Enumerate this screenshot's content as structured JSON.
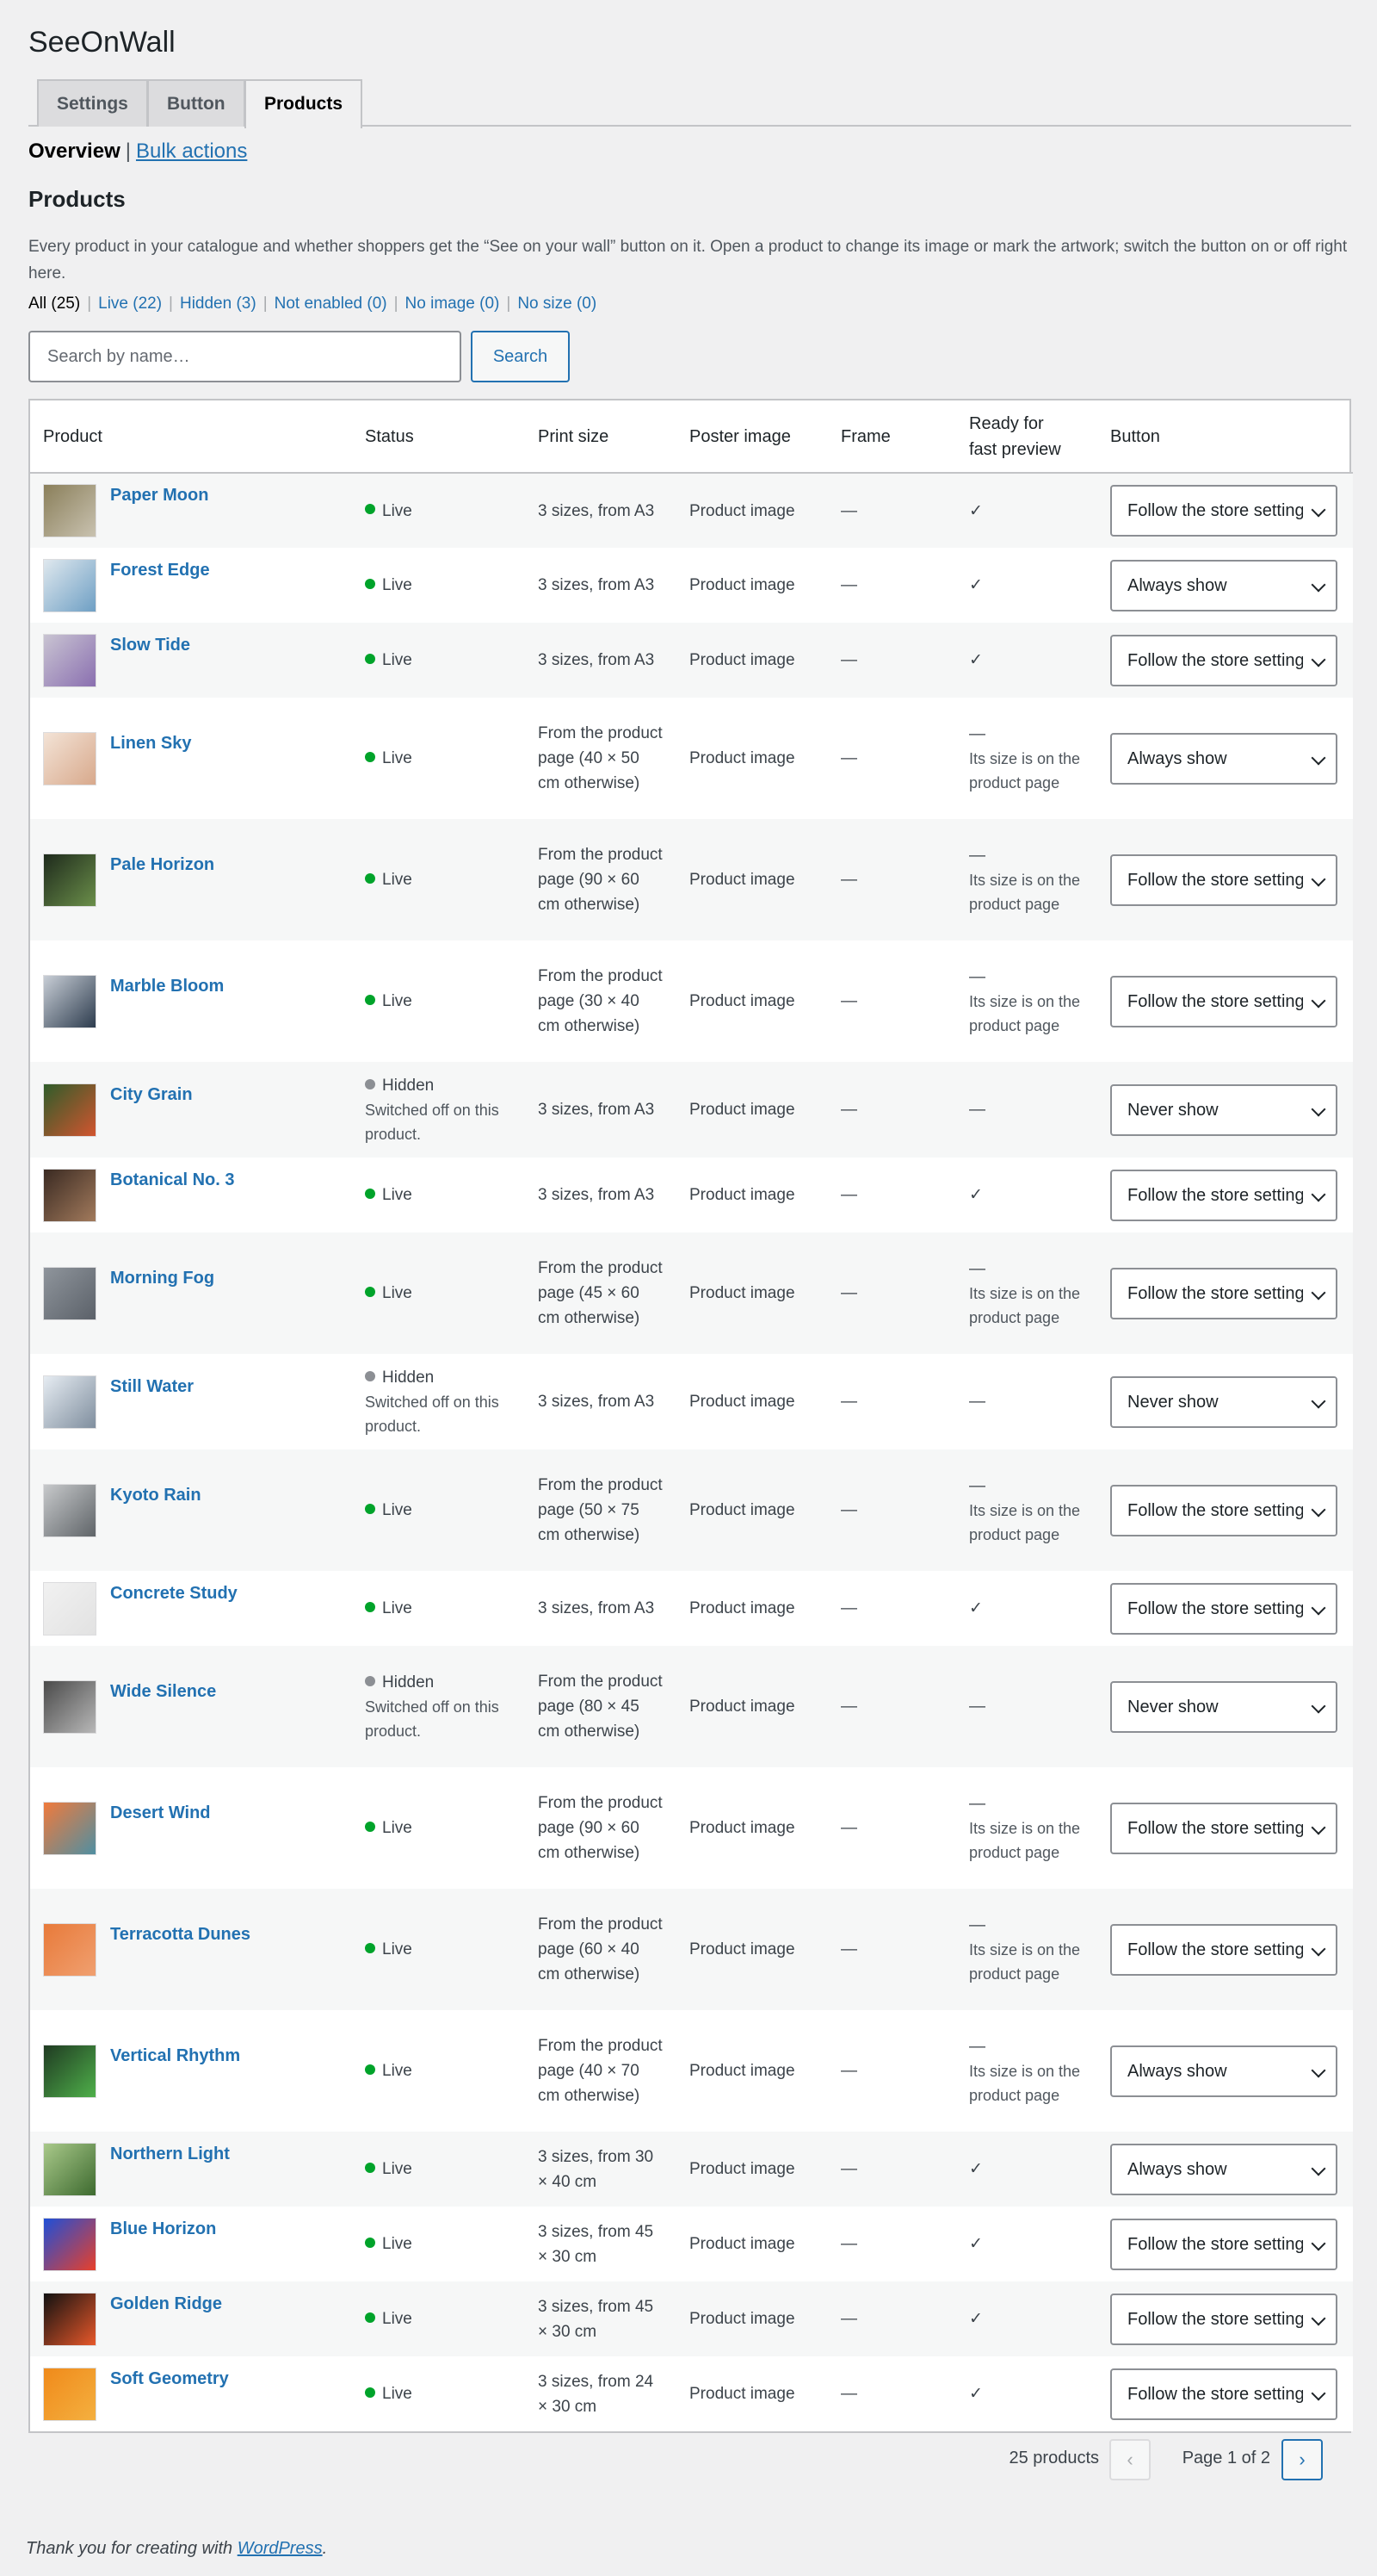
{
  "app": {
    "title": "SeeOnWall"
  },
  "tabs": [
    {
      "label": "Settings",
      "active": false
    },
    {
      "label": "Button",
      "active": false
    },
    {
      "label": "Products",
      "active": true
    }
  ],
  "subnav": {
    "current": "Overview",
    "separator": "|",
    "link": "Bulk actions"
  },
  "section": {
    "title": "Products",
    "description": "Every product in your catalogue and whether shoppers get the “See on your wall” button on it. Open a product to change its image or mark the artwork; switch the button on or off right here."
  },
  "filters": [
    {
      "label": "All (25)",
      "current": true
    },
    {
      "label": "Live (22)",
      "current": false
    },
    {
      "label": "Hidden (3)",
      "current": false
    },
    {
      "label": "Not enabled (0)",
      "current": false
    },
    {
      "label": "No image (0)",
      "current": false
    },
    {
      "label": "No size (0)",
      "current": false
    }
  ],
  "filter_separator": "|",
  "search": {
    "placeholder": "Search by name…",
    "button": "Search"
  },
  "columns": {
    "product": "Product",
    "status": "Status",
    "print_size": "Print size",
    "poster": "Poster image",
    "frame": "Frame",
    "ready": "Ready for fast preview",
    "button": "Button"
  },
  "colors": {
    "live": "#00a32a",
    "hidden": "#8c8f94",
    "accent": "#2271b1"
  },
  "rows": [
    {
      "name": "Paper Moon",
      "status": "Live",
      "status_note": "",
      "print": "3 sizes, from A3",
      "poster": "Product image",
      "frame": "—",
      "ready": "✓",
      "ready_note": "",
      "button": "Follow the store settings",
      "thumb": [
        "#8a7f5a",
        "#c9c2b0"
      ]
    },
    {
      "name": "Forest Edge",
      "status": "Live",
      "status_note": "",
      "print": "3 sizes, from A3",
      "poster": "Product image",
      "frame": "—",
      "ready": "✓",
      "ready_note": "",
      "button": "Always show",
      "thumb": [
        "#dfe8ee",
        "#6e9fc4"
      ]
    },
    {
      "name": "Slow Tide",
      "status": "Live",
      "status_note": "",
      "print": "3 sizes, from A3",
      "poster": "Product image",
      "frame": "—",
      "ready": "✓",
      "ready_note": "",
      "button": "Follow the store settings",
      "thumb": [
        "#c9c4d2",
        "#8a6fb0"
      ]
    },
    {
      "name": "Linen Sky",
      "status": "Live",
      "status_note": "",
      "print": "From the product page (40 × 50 cm otherwise)",
      "poster": "Product image",
      "frame": "—",
      "ready": "—",
      "ready_note": "Its size is on the product page",
      "button": "Always show",
      "thumb": [
        "#f3e3d6",
        "#d8a98c"
      ]
    },
    {
      "name": "Pale Horizon",
      "status": "Live",
      "status_note": "",
      "print": "From the product page (90 × 60 cm otherwise)",
      "poster": "Product image",
      "frame": "—",
      "ready": "—",
      "ready_note": "Its size is on the product page",
      "button": "Follow the store settings",
      "thumb": [
        "#1e2a1c",
        "#6b8f4a"
      ]
    },
    {
      "name": "Marble Bloom",
      "status": "Live",
      "status_note": "",
      "print": "From the product page (30 × 40 cm otherwise)",
      "poster": "Product image",
      "frame": "—",
      "ready": "—",
      "ready_note": "Its size is on the product page",
      "button": "Follow the store settings",
      "thumb": [
        "#c8ced6",
        "#2d3c4e"
      ]
    },
    {
      "name": "City Grain",
      "status": "Hidden",
      "status_note": "Switched off on this product.",
      "print": "3 sizes, from A3",
      "poster": "Product image",
      "frame": "—",
      "ready": "—",
      "ready_note": "",
      "button": "Never show",
      "thumb": [
        "#2f5c2a",
        "#d2552f"
      ]
    },
    {
      "name": "Botanical No. 3",
      "status": "Live",
      "status_note": "",
      "print": "3 sizes, from A3",
      "poster": "Product image",
      "frame": "—",
      "ready": "✓",
      "ready_note": "",
      "button": "Follow the store settings",
      "thumb": [
        "#3a2a22",
        "#a27a5c"
      ]
    },
    {
      "name": "Morning Fog",
      "status": "Live",
      "status_note": "",
      "print": "From the product page (45 × 60 cm otherwise)",
      "poster": "Product image",
      "frame": "—",
      "ready": "—",
      "ready_note": "Its size is on the product page",
      "button": "Follow the store settings",
      "thumb": [
        "#8f959c",
        "#5b6169"
      ]
    },
    {
      "name": "Still Water",
      "status": "Hidden",
      "status_note": "Switched off on this product.",
      "print": "3 sizes, from A3",
      "poster": "Product image",
      "frame": "—",
      "ready": "—",
      "ready_note": "",
      "button": "Never show",
      "thumb": [
        "#e6ecf2",
        "#7f8e9e"
      ]
    },
    {
      "name": "Kyoto Rain",
      "status": "Live",
      "status_note": "",
      "print": "From the product page (50 × 75 cm otherwise)",
      "poster": "Product image",
      "frame": "—",
      "ready": "—",
      "ready_note": "Its size is on the product page",
      "button": "Follow the store settings",
      "thumb": [
        "#c7c9cb",
        "#5f6468"
      ]
    },
    {
      "name": "Concrete Study",
      "status": "Live",
      "status_note": "",
      "print": "3 sizes, from A3",
      "poster": "Product image",
      "frame": "—",
      "ready": "✓",
      "ready_note": "",
      "button": "Follow the store settings",
      "thumb": [
        "#f1f1f1",
        "#e2e2e2"
      ]
    },
    {
      "name": "Wide Silence",
      "status": "Hidden",
      "status_note": "Switched off on this product.",
      "print": "From the product page (80 × 45 cm otherwise)",
      "poster": "Product image",
      "frame": "—",
      "ready": "—",
      "ready_note": "",
      "button": "Never show",
      "thumb": [
        "#4a4a4a",
        "#b8b8b8"
      ]
    },
    {
      "name": "Desert Wind",
      "status": "Live",
      "status_note": "",
      "print": "From the product page (90 × 60 cm otherwise)",
      "poster": "Product image",
      "frame": "—",
      "ready": "—",
      "ready_note": "Its size is on the product page",
      "button": "Follow the store settings",
      "thumb": [
        "#f07a3c",
        "#4f8fa2"
      ]
    },
    {
      "name": "Terracotta Dunes",
      "status": "Live",
      "status_note": "",
      "print": "From the product page (60 × 40 cm otherwise)",
      "poster": "Product image",
      "frame": "—",
      "ready": "—",
      "ready_note": "Its size is on the product page",
      "button": "Follow the store settings",
      "thumb": [
        "#e87a3a",
        "#f0a070"
      ]
    },
    {
      "name": "Vertical Rhythm",
      "status": "Live",
      "status_note": "",
      "print": "From the product page (40 × 70 cm otherwise)",
      "poster": "Product image",
      "frame": "—",
      "ready": "—",
      "ready_note": "Its size is on the product page",
      "button": "Always show",
      "thumb": [
        "#1f3a22",
        "#4fb04a"
      ]
    },
    {
      "name": "Northern Light",
      "status": "Live",
      "status_note": "",
      "print": "3 sizes, from 30 × 40 cm",
      "poster": "Product image",
      "frame": "—",
      "ready": "✓",
      "ready_note": "",
      "button": "Always show",
      "thumb": [
        "#a9c98a",
        "#3d6a2f"
      ]
    },
    {
      "name": "Blue Horizon",
      "status": "Live",
      "status_note": "",
      "print": "3 sizes, from 45 × 30 cm",
      "poster": "Product image",
      "frame": "—",
      "ready": "✓",
      "ready_note": "",
      "button": "Follow the store settings",
      "thumb": [
        "#1e4fd8",
        "#e8402a"
      ]
    },
    {
      "name": "Golden Ridge",
      "status": "Live",
      "status_note": "",
      "print": "3 sizes, from 45 × 30 cm",
      "poster": "Product image",
      "frame": "—",
      "ready": "✓",
      "ready_note": "",
      "button": "Follow the store settings",
      "thumb": [
        "#111111",
        "#e8582a"
      ]
    },
    {
      "name": "Soft Geometry",
      "status": "Live",
      "status_note": "",
      "print": "3 sizes, from 24 × 30 cm",
      "poster": "Product image",
      "frame": "—",
      "ready": "✓",
      "ready_note": "",
      "button": "Follow the store settings",
      "thumb": [
        "#f08a1a",
        "#f4b040"
      ]
    }
  ],
  "pagination": {
    "count": "25 products",
    "info": "Page 1 of 2",
    "prev": "‹",
    "next": "›"
  },
  "footer": {
    "text": "Thank you for creating with ",
    "link": "WordPress",
    "end": "."
  }
}
